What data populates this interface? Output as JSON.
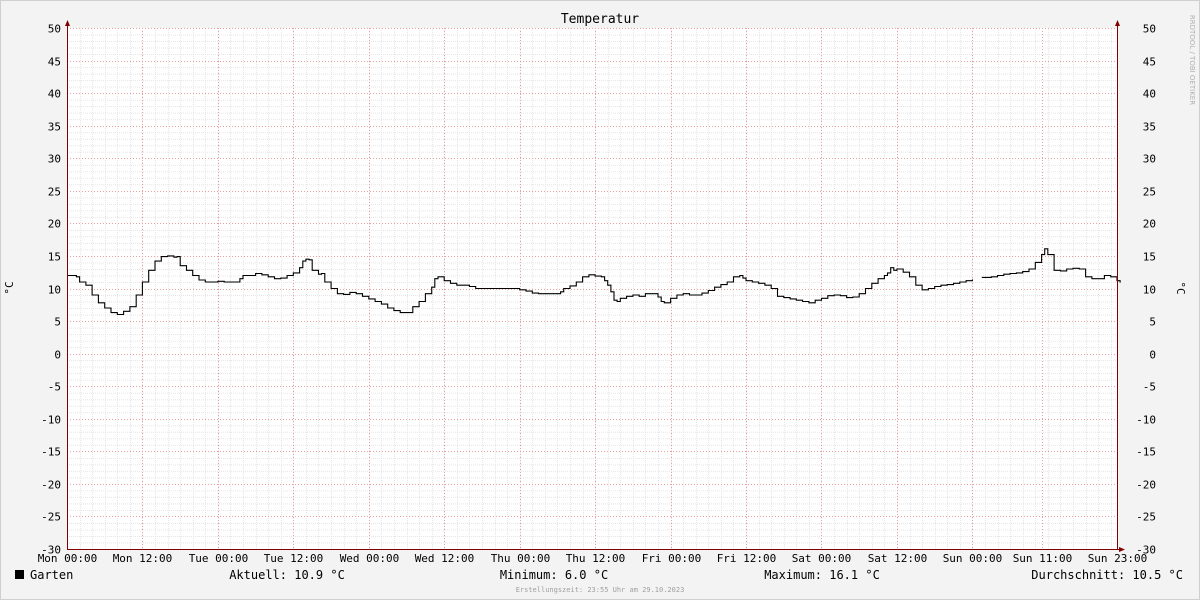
{
  "chart_data": {
    "type": "line",
    "title": "Temperatur",
    "ylabel_left": "°C",
    "ylabel_right": "°C",
    "ylim": [
      -30,
      50
    ],
    "yticks": [
      50,
      45,
      40,
      35,
      30,
      25,
      20,
      15,
      10,
      5,
      0,
      -5,
      -10,
      -15,
      -20,
      -25,
      -30
    ],
    "xlim": [
      0,
      167
    ],
    "xticks": [
      {
        "h": 0,
        "label": "Mon 00:00"
      },
      {
        "h": 12,
        "label": "Mon 12:00"
      },
      {
        "h": 24,
        "label": "Tue 00:00"
      },
      {
        "h": 36,
        "label": "Tue 12:00"
      },
      {
        "h": 48,
        "label": "Wed 00:00"
      },
      {
        "h": 60,
        "label": "Wed 12:00"
      },
      {
        "h": 72,
        "label": "Thu 00:00"
      },
      {
        "h": 84,
        "label": "Thu 12:00"
      },
      {
        "h": 96,
        "label": "Fri 00:00"
      },
      {
        "h": 108,
        "label": "Fri 12:00"
      },
      {
        "h": 120,
        "label": "Sat 00:00"
      },
      {
        "h": 132,
        "label": "Sat 12:00"
      },
      {
        "h": 144,
        "label": "Sun 00:00"
      },
      {
        "h": 155,
        "label": "Sun 11:00"
      },
      {
        "h": 167,
        "label": "Sun 23:00"
      }
    ],
    "grid": true,
    "series": [
      {
        "name": "Garten",
        "color": "#000000",
        "points": [
          [
            0,
            12.0
          ],
          [
            1.5,
            11.8
          ],
          [
            2,
            11.0
          ],
          [
            3,
            10.5
          ],
          [
            4,
            9.0
          ],
          [
            5,
            7.8
          ],
          [
            6,
            7.0
          ],
          [
            7,
            6.3
          ],
          [
            8,
            6.0
          ],
          [
            9,
            6.5
          ],
          [
            10,
            7.2
          ],
          [
            11,
            9.0
          ],
          [
            12,
            11.0
          ],
          [
            13,
            12.8
          ],
          [
            14,
            14.2
          ],
          [
            15,
            14.9
          ],
          [
            16,
            15.0
          ],
          [
            17,
            14.8
          ],
          [
            17.5,
            14.9
          ],
          [
            18,
            13.5
          ],
          [
            19,
            12.8
          ],
          [
            20,
            12.0
          ],
          [
            21,
            11.3
          ],
          [
            22,
            11.0
          ],
          [
            23,
            11.0
          ],
          [
            24,
            11.1
          ],
          [
            25,
            11.0
          ],
          [
            26,
            11.0
          ],
          [
            27,
            11.0
          ],
          [
            27.5,
            11.5
          ],
          [
            28,
            12.0
          ],
          [
            30,
            12.3
          ],
          [
            31,
            12.1
          ],
          [
            32,
            11.8
          ],
          [
            33,
            11.5
          ],
          [
            34,
            11.6
          ],
          [
            35,
            12.0
          ],
          [
            36,
            12.4
          ],
          [
            37,
            13.2
          ],
          [
            37.5,
            14.2
          ],
          [
            38,
            14.5
          ],
          [
            38.5,
            14.4
          ],
          [
            39,
            12.8
          ],
          [
            40,
            12.2
          ],
          [
            40.5,
            12.3
          ],
          [
            41,
            11.0
          ],
          [
            42,
            10.0
          ],
          [
            43,
            9.2
          ],
          [
            44,
            9.1
          ],
          [
            45,
            9.4
          ],
          [
            46,
            9.2
          ],
          [
            47,
            8.8
          ],
          [
            48,
            8.4
          ],
          [
            49,
            8.0
          ],
          [
            50,
            7.6
          ],
          [
            51,
            7.0
          ],
          [
            52,
            6.6
          ],
          [
            53,
            6.3
          ],
          [
            54,
            6.3
          ],
          [
            55,
            7.2
          ],
          [
            56,
            8.0
          ],
          [
            57,
            9.2
          ],
          [
            58,
            10.2
          ],
          [
            58.5,
            11.5
          ],
          [
            59,
            11.8
          ],
          [
            60,
            11.2
          ],
          [
            61,
            10.8
          ],
          [
            62,
            10.5
          ],
          [
            63,
            10.5
          ],
          [
            64,
            10.3
          ],
          [
            65,
            10.0
          ],
          [
            66,
            10.0
          ],
          [
            67,
            10.0
          ],
          [
            68,
            10.0
          ],
          [
            69,
            10.0
          ],
          [
            70,
            10.0
          ],
          [
            71,
            10.0
          ],
          [
            72,
            9.8
          ],
          [
            73,
            9.6
          ],
          [
            74,
            9.3
          ],
          [
            75,
            9.2
          ],
          [
            76,
            9.2
          ],
          [
            77,
            9.2
          ],
          [
            78,
            9.2
          ],
          [
            78.5,
            9.5
          ],
          [
            79,
            10.0
          ],
          [
            80,
            10.4
          ],
          [
            81,
            11.0
          ],
          [
            82,
            11.8
          ],
          [
            83,
            12.1
          ],
          [
            84,
            11.9
          ],
          [
            85,
            11.8
          ],
          [
            85.5,
            11.2
          ],
          [
            86,
            10.5
          ],
          [
            86.5,
            9.5
          ],
          [
            87,
            8.2
          ],
          [
            87.5,
            8.0
          ],
          [
            88,
            8.5
          ],
          [
            89,
            8.8
          ],
          [
            90,
            9.0
          ],
          [
            91,
            8.8
          ],
          [
            92,
            9.2
          ],
          [
            93,
            9.2
          ],
          [
            94,
            8.7
          ],
          [
            94.5,
            8.0
          ],
          [
            95,
            7.8
          ],
          [
            96,
            8.5
          ],
          [
            97,
            9.0
          ],
          [
            98,
            9.2
          ],
          [
            99,
            9.0
          ],
          [
            100,
            9.0
          ],
          [
            101,
            9.3
          ],
          [
            102,
            9.7
          ],
          [
            103,
            10.2
          ],
          [
            104,
            10.6
          ],
          [
            105,
            11.0
          ],
          [
            106,
            11.8
          ],
          [
            107,
            12.0
          ],
          [
            107.5,
            11.6
          ],
          [
            108,
            11.2
          ],
          [
            109,
            11.0
          ],
          [
            110,
            10.8
          ],
          [
            111,
            10.5
          ],
          [
            112,
            10.0
          ],
          [
            113,
            8.8
          ],
          [
            114,
            8.6
          ],
          [
            115,
            8.4
          ],
          [
            116,
            8.2
          ],
          [
            117,
            8.0
          ],
          [
            118,
            7.8
          ],
          [
            119,
            8.2
          ],
          [
            120,
            8.5
          ],
          [
            121,
            8.9
          ],
          [
            122,
            9.0
          ],
          [
            123,
            8.9
          ],
          [
            124,
            8.6
          ],
          [
            125,
            8.7
          ],
          [
            126,
            9.2
          ],
          [
            127,
            10.0
          ],
          [
            128,
            10.8
          ],
          [
            129,
            11.5
          ],
          [
            130,
            12.0
          ],
          [
            130.5,
            12.4
          ],
          [
            131,
            13.2
          ],
          [
            131.5,
            12.8
          ],
          [
            132,
            13.0
          ],
          [
            133,
            12.5
          ],
          [
            134,
            11.8
          ],
          [
            135,
            10.5
          ],
          [
            136,
            9.8
          ],
          [
            137,
            10.0
          ],
          [
            138,
            10.3
          ],
          [
            139,
            10.5
          ],
          [
            140,
            10.6
          ],
          [
            141,
            10.8
          ],
          [
            142,
            11.0
          ],
          [
            143,
            11.2
          ],
          [
            144,
            11.4
          ],
          [
            145,
            null
          ],
          [
            145.5,
            11.7
          ],
          [
            146,
            11.7
          ],
          [
            147,
            11.8
          ],
          [
            148,
            12.0
          ],
          [
            149,
            12.2
          ],
          [
            150,
            12.3
          ],
          [
            151,
            12.4
          ],
          [
            152,
            12.6
          ],
          [
            153,
            13.0
          ],
          [
            154,
            14.0
          ],
          [
            155,
            15.2
          ],
          [
            155.5,
            16.1
          ],
          [
            156,
            15.2
          ],
          [
            157,
            12.8
          ],
          [
            158,
            12.7
          ],
          [
            159,
            13.0
          ],
          [
            160,
            13.1
          ],
          [
            161,
            13.0
          ],
          [
            162,
            11.8
          ],
          [
            163,
            11.5
          ],
          [
            164,
            11.5
          ],
          [
            165,
            12.0
          ],
          [
            166,
            11.8
          ],
          [
            167,
            11.2
          ],
          [
            167.5,
            10.9
          ]
        ]
      }
    ],
    "legend": {
      "label": "Garten",
      "aktuell": "Aktuell: 10.9 °C",
      "minimum": "Minimum: 6.0 °C",
      "maximum": "Maximum: 16.1 °C",
      "durchschnitt": "Durchschnitt: 10.5 °C"
    },
    "footer": "Erstellungszeit: 23:55 Uhr am 29.10.2023",
    "watermark": "RRDTOOL / TOBI OETIKER",
    "colors": {
      "background": "#f3f3f3",
      "canvas": "#ffffff",
      "minor_grid": "#e5e5e5",
      "major_grid": "#e8a0a0",
      "axis": "#800000",
      "line": "#000000",
      "text": "#000000",
      "footer_text": "#a0a0a0"
    }
  }
}
